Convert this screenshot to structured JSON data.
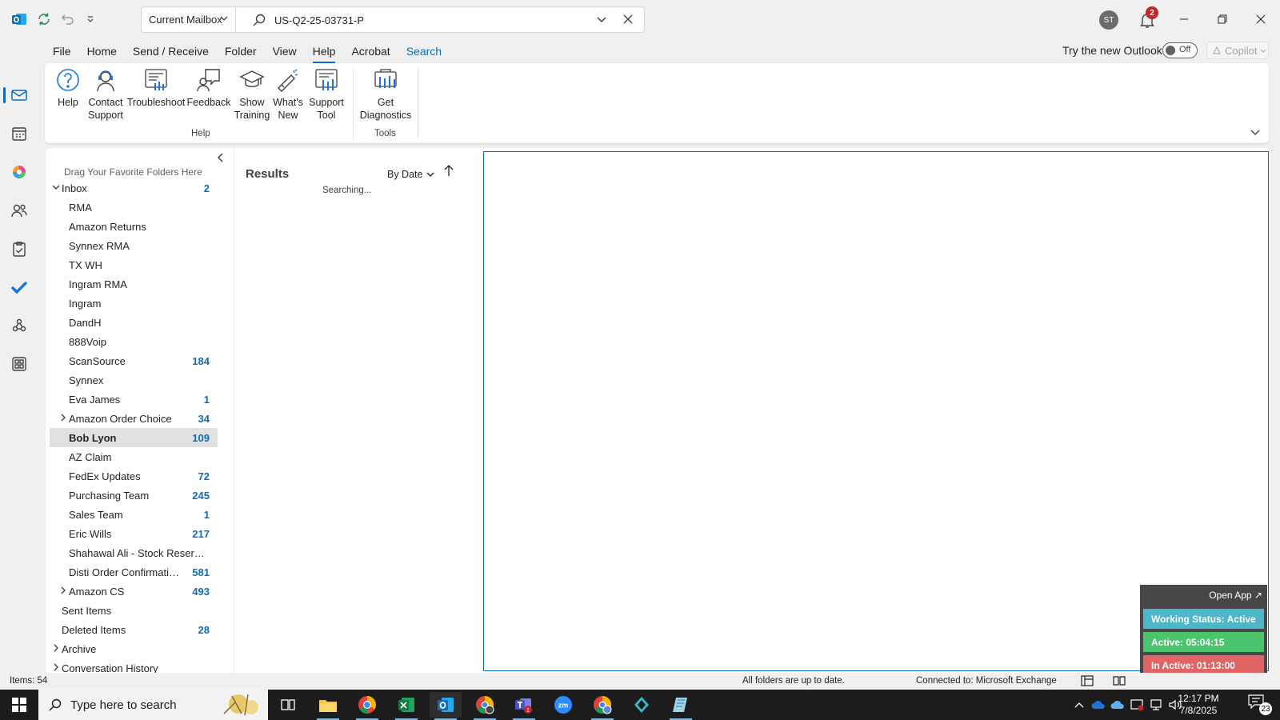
{
  "titlebar": {
    "mailbox_scope": "Current Mailbox",
    "search_value": "US-Q2-25-03731-P",
    "avatar_initials": "ST",
    "notification_count": "2"
  },
  "menu": {
    "tabs": [
      {
        "label": "File"
      },
      {
        "label": "Home"
      },
      {
        "label": "Send / Receive"
      },
      {
        "label": "Folder"
      },
      {
        "label": "View"
      },
      {
        "label": "Help"
      },
      {
        "label": "Acrobat"
      },
      {
        "label": "Search"
      }
    ],
    "active_tab": "Help",
    "try_new": "Try the new Outlook",
    "toggle_label": "Off",
    "copilot": "Copilot"
  },
  "ribbon": {
    "buttons": {
      "help": [
        "Help"
      ],
      "contact_support": [
        "Contact",
        "Support"
      ],
      "troubleshoot": [
        "Troubleshoot"
      ],
      "feedback": [
        "Feedback"
      ],
      "show_training": [
        "Show",
        "Training"
      ],
      "whats_new": [
        "What's",
        "New"
      ],
      "support_tool": [
        "Support",
        "Tool"
      ],
      "get_diagnostics": [
        "Get",
        "Diagnostics"
      ]
    },
    "groups": {
      "help": "Help",
      "tools": "Tools"
    }
  },
  "folder_pane": {
    "favorites_hint": "Drag Your Favorite Folders Here",
    "folders": [
      {
        "name": "Inbox",
        "count": "2",
        "level": 0,
        "expander": "v"
      },
      {
        "name": "RMA",
        "count": "",
        "level": 1,
        "expander": ""
      },
      {
        "name": "Amazon Returns",
        "count": "",
        "level": 1,
        "expander": ""
      },
      {
        "name": "Synnex RMA",
        "count": "",
        "level": 1,
        "expander": ""
      },
      {
        "name": "TX WH",
        "count": "",
        "level": 1,
        "expander": ""
      },
      {
        "name": "Ingram RMA",
        "count": "",
        "level": 1,
        "expander": ""
      },
      {
        "name": "Ingram",
        "count": "",
        "level": 1,
        "expander": ""
      },
      {
        "name": "DandH",
        "count": "",
        "level": 1,
        "expander": ""
      },
      {
        "name": "888Voip",
        "count": "",
        "level": 1,
        "expander": ""
      },
      {
        "name": "ScanSource",
        "count": "184",
        "level": 1,
        "expander": ""
      },
      {
        "name": "Synnex",
        "count": "",
        "level": 1,
        "expander": ""
      },
      {
        "name": "Eva James",
        "count": "1",
        "level": 1,
        "expander": ""
      },
      {
        "name": "Amazon Order Choice",
        "count": "34",
        "level": 1,
        "expander": ">"
      },
      {
        "name": "Bob Lyon",
        "count": "109",
        "level": 1,
        "expander": "",
        "selected": true
      },
      {
        "name": "AZ Claim",
        "count": "",
        "level": 1,
        "expander": ""
      },
      {
        "name": "FedEx Updates",
        "count": "72",
        "level": 1,
        "expander": ""
      },
      {
        "name": "Purchasing Team",
        "count": "245",
        "level": 1,
        "expander": ""
      },
      {
        "name": "Sales Team",
        "count": "1",
        "level": 1,
        "expander": ""
      },
      {
        "name": "Eric Wills",
        "count": "217",
        "level": 1,
        "expander": ""
      },
      {
        "name": "Shahawal Ali - Stock Reservati...",
        "count": "",
        "level": 1,
        "expander": ""
      },
      {
        "name": "Disti Order Confirmations",
        "count": "581",
        "level": 1,
        "expander": ""
      },
      {
        "name": "Amazon CS",
        "count": "493",
        "level": 1,
        "expander": ">"
      },
      {
        "name": "Sent Items",
        "count": "",
        "level": 0,
        "expander": ""
      },
      {
        "name": "Deleted Items",
        "count": "28",
        "level": 0,
        "expander": ""
      },
      {
        "name": "Archive",
        "count": "",
        "level": 0,
        "expander": ">"
      },
      {
        "name": "Conversation History",
        "count": "",
        "level": 0,
        "expander": ">"
      }
    ]
  },
  "message_list": {
    "title": "Results",
    "sort_label": "By Date",
    "status": "Searching..."
  },
  "widget": {
    "open_app": "Open App ↗",
    "working_status": "Working Status: Active",
    "active": "Active: 05:04:15",
    "inactive": "In Active: 01:13:00",
    "colors": {
      "status": "#4db6c8",
      "active": "#4cc46e",
      "inactive": "#e06464"
    }
  },
  "statusbar": {
    "items": "Items: 54",
    "sync": "All folders are up to date.",
    "connection": "Connected to: Microsoft Exchange"
  },
  "taskbar": {
    "search_placeholder": "Type here to search",
    "time": "12:17 PM",
    "date": "7/8/2025",
    "notification_count": "23"
  },
  "colors": {
    "accent": "#0f6cbd",
    "count": "#0f6cbd",
    "taskbar": "#1c1c1c"
  }
}
